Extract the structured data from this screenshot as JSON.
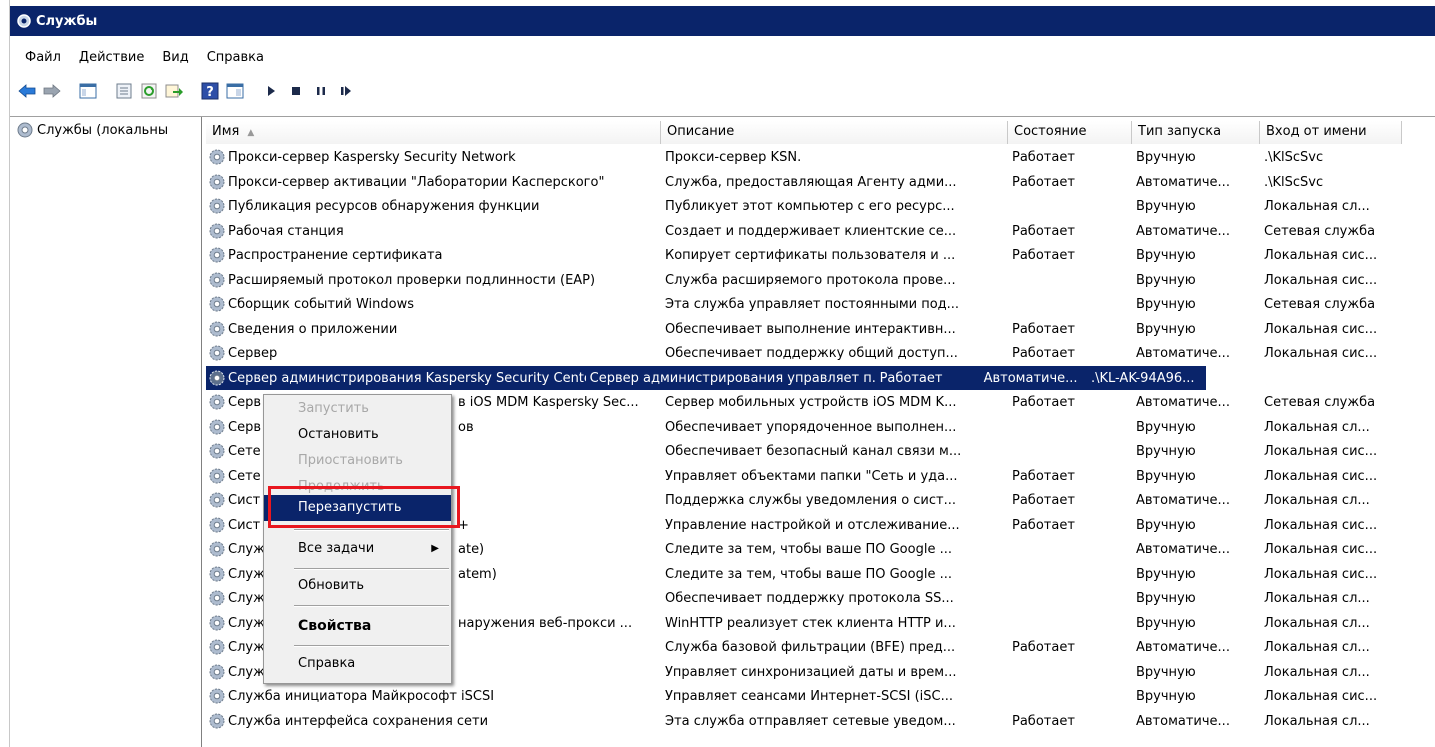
{
  "window": {
    "title": "Службы"
  },
  "menu": [
    "Файл",
    "Действие",
    "Вид",
    "Справка"
  ],
  "tree": {
    "root_label": "Службы (локальны"
  },
  "columns": [
    "Имя",
    "Описание",
    "Состояние",
    "Тип запуска",
    "Вход от имени"
  ],
  "services": [
    {
      "name": "Прокси-сервер Kaspersky Security Network",
      "desc": "Прокси-сервер KSN.",
      "state": "Работает",
      "startup": "Вручную",
      "logon": ".\\KlScSvc"
    },
    {
      "name": "Прокси-сервер активации \"Лаборатории Касперского\"",
      "desc": "Служба, предоставляющая Агенту адми...",
      "state": "Работает",
      "startup": "Автоматиче...",
      "logon": ".\\KlScSvc"
    },
    {
      "name": "Публикация ресурсов обнаружения функции",
      "desc": "Публикует этот компьютер с его ресурс...",
      "state": "",
      "startup": "Вручную",
      "logon": "Локальная сл..."
    },
    {
      "name": "Рабочая станция",
      "desc": "Создает и поддерживает клиентские се...",
      "state": "Работает",
      "startup": "Автоматиче...",
      "logon": "Сетевая служба"
    },
    {
      "name": "Распространение сертификата",
      "desc": "Копирует сертификаты пользователя и ...",
      "state": "Работает",
      "startup": "Вручную",
      "logon": "Локальная сис..."
    },
    {
      "name": "Расширяемый протокол проверки подлинности (EAP)",
      "desc": "Служба расширяемого протокола прове...",
      "state": "",
      "startup": "Вручную",
      "logon": "Локальная сис..."
    },
    {
      "name": "Сборщик событий Windows",
      "desc": "Эта служба управляет постоянными под...",
      "state": "",
      "startup": "Вручную",
      "logon": "Сетевая служба"
    },
    {
      "name": "Сведения о приложении",
      "desc": "Обеспечивает выполнение интерактивн...",
      "state": "Работает",
      "startup": "Вручную",
      "logon": "Локальная сис..."
    },
    {
      "name": "Сервер",
      "desc": "Обеспечивает поддержку общий доступ...",
      "state": "Работает",
      "startup": "Автоматиче...",
      "logon": "Локальная сис..."
    },
    {
      "name": "Сервер администрирования Kaspersky Security Center...",
      "desc": "Сервер администрирования управляет п...",
      "state": "Работает",
      "startup": "Автоматиче...",
      "logon": ".\\KL-AK-94A96..."
    },
    {
      "name": "Серв",
      "name_right": "в iOS MDM Kaspersky Sec...",
      "desc": "Сервер мобильных устройств iOS MDM K...",
      "state": "Работает",
      "startup": "Автоматиче...",
      "logon": "Сетевая служба"
    },
    {
      "name": "Серв",
      "name_right": "ов",
      "desc": "Обеспечивает упорядоченное выполнен...",
      "state": "",
      "startup": "Вручную",
      "logon": "Локальная сл..."
    },
    {
      "name": "Сете",
      "name_right": "",
      "desc": "Обеспечивает безопасный канал связи м...",
      "state": "",
      "startup": "Вручную",
      "logon": "Локальная сис..."
    },
    {
      "name": "Сете",
      "name_right": "",
      "desc": "Управляет объектами папки \"Сеть и уда...",
      "state": "Работает",
      "startup": "Вручную",
      "logon": "Локальная сис..."
    },
    {
      "name": "Сист",
      "name_right": "",
      "desc": "Поддержка службы уведомления о сист...",
      "state": "Работает",
      "startup": "Автоматиче...",
      "logon": "Локальная сл..."
    },
    {
      "name": "Сист",
      "name_right": "+",
      "desc": "Управление настройкой и отслеживание...",
      "state": "Работает",
      "startup": "Вручную",
      "logon": "Локальная сис..."
    },
    {
      "name": "Служ",
      "name_right": "ate)",
      "desc": "Следите за тем, чтобы ваше ПО Google ...",
      "state": "",
      "startup": "Автоматиче...",
      "logon": "Локальная сис..."
    },
    {
      "name": "Служ",
      "name_right": "atem)",
      "desc": "Следите за тем, чтобы ваше ПО Google ...",
      "state": "",
      "startup": "Вручную",
      "logon": "Локальная сис..."
    },
    {
      "name": "Служ",
      "name_right": "",
      "desc": "Обеспечивает поддержку протокола SS...",
      "state": "",
      "startup": "Вручную",
      "logon": "Локальная сл..."
    },
    {
      "name": "Служ",
      "name_right": "наружения веб-прокси ...",
      "desc": "WinHTTP реализует стек клиента HTTP и...",
      "state": "",
      "startup": "Вручную",
      "logon": "Локальная сл..."
    },
    {
      "name": "Служ",
      "name_right": "",
      "desc": "Служба базовой фильтрации (BFE) пред...",
      "state": "Работает",
      "startup": "Автоматиче...",
      "logon": "Локальная сл..."
    },
    {
      "name": "Служба времени Windows",
      "desc": "Управляет синхронизацией даты и врем...",
      "state": "",
      "startup": "Вручную",
      "logon": "Локальная сл..."
    },
    {
      "name": "Служба инициатора Майкрософт iSCSI",
      "desc": "Управляет сеансами Интернет-SCSI (iSC...",
      "state": "",
      "startup": "Вручную",
      "logon": "Локальная сис..."
    },
    {
      "name": "Служба интерфейса сохранения сети",
      "desc": "Эта служба отправляет сетевые уведом...",
      "state": "Работает",
      "startup": "Автоматиче...",
      "logon": "Локальная сл..."
    }
  ],
  "selected_index": 9,
  "context_menu": {
    "start": "Запустить",
    "stop": "Остановить",
    "pause": "Приостановить",
    "resume": "Продолжить",
    "restart": "Перезапустить",
    "all_tasks": "Все задачи",
    "refresh": "Обновить",
    "properties": "Свойства",
    "help": "Справка"
  },
  "colors": {
    "title_bar": "#0a246a",
    "selection": "#0a246a",
    "highlight_box": "#e8171f"
  },
  "icons": [
    "back-icon",
    "forward-icon",
    "console-tree-icon",
    "properties-icon",
    "refresh-icon",
    "export-icon",
    "help-icon",
    "view-icon",
    "play-icon",
    "stop-icon",
    "pause-icon",
    "resume-icon",
    "gear-icon"
  ]
}
